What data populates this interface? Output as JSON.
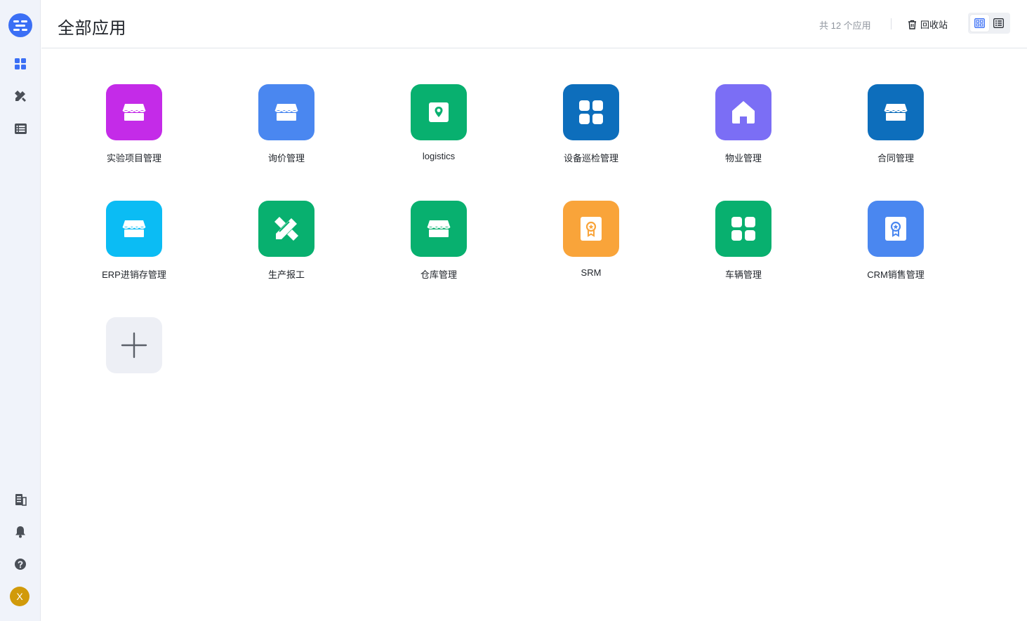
{
  "header": {
    "title": "全部应用",
    "app_count": "共 12 个应用",
    "recycle_label": "回收站"
  },
  "sidebar": {
    "top_items": [
      {
        "icon": "grid-icon",
        "active": true
      },
      {
        "icon": "pencil-ruler-icon"
      },
      {
        "icon": "list-icon"
      }
    ],
    "bottom_items": [
      {
        "icon": "building-icon"
      },
      {
        "icon": "bell-icon"
      },
      {
        "icon": "help-icon"
      }
    ],
    "avatar_initial": "X"
  },
  "colors": {
    "accent": "#3b6ff5",
    "sidebar_bg": "#f0f3fa"
  },
  "apps": [
    {
      "name": "实验项目管理",
      "icon": "store-icon",
      "color": "#c42be8"
    },
    {
      "name": "询价管理",
      "icon": "store-icon",
      "color": "#4a87f0"
    },
    {
      "name": "logistics",
      "icon": "map-pin-icon",
      "color": "#08b06f"
    },
    {
      "name": "设备巡检管理",
      "icon": "grid-icon",
      "color": "#0d6ebc"
    },
    {
      "name": "物业管理",
      "icon": "home-icon",
      "color": "#7b6ef5"
    },
    {
      "name": "合同管理",
      "icon": "store-icon",
      "color": "#0d6ebc"
    },
    {
      "name": "ERP进销存管理",
      "icon": "store-icon",
      "color": "#0bbcf4"
    },
    {
      "name": "生产报工",
      "icon": "pencil-ruler-icon",
      "color": "#08b06f"
    },
    {
      "name": "仓库管理",
      "icon": "store-icon",
      "color": "#08b06f"
    },
    {
      "name": "SRM",
      "icon": "award-icon",
      "color": "#f9a43a"
    },
    {
      "name": "车辆管理",
      "icon": "grid-icon",
      "color": "#08b06f"
    },
    {
      "name": "CRM销售管理",
      "icon": "award-icon",
      "color": "#4a87f0"
    }
  ]
}
